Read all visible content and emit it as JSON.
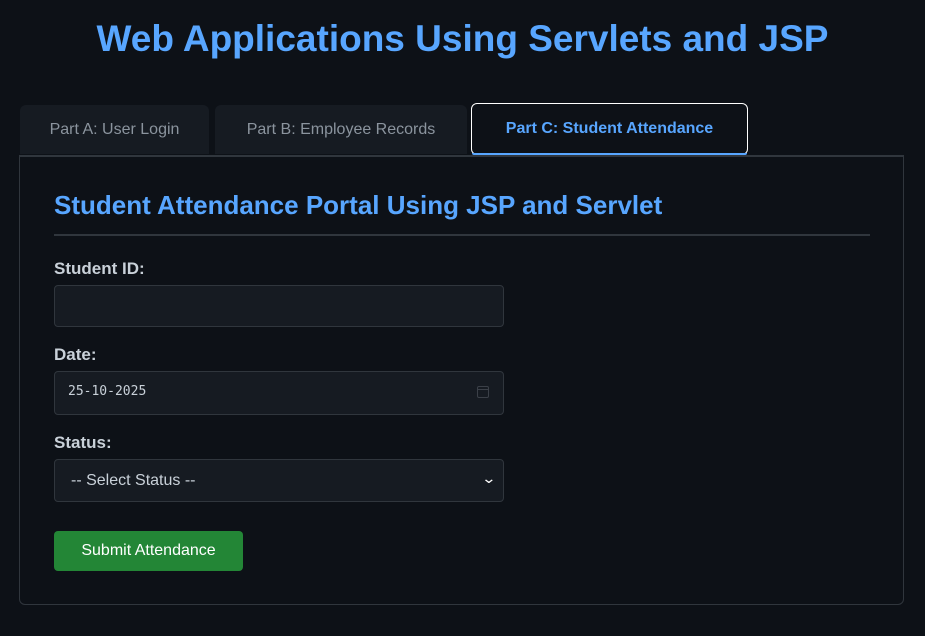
{
  "header": {
    "title": "Web Applications Using Servlets and JSP"
  },
  "tabs": [
    {
      "label": "Part A: User Login",
      "active": false
    },
    {
      "label": "Part B: Employee Records",
      "active": false
    },
    {
      "label": "Part C: Student Attendance",
      "active": true
    }
  ],
  "panel": {
    "title": "Student Attendance Portal Using JSP and Servlet",
    "form": {
      "student_id": {
        "label": "Student ID:",
        "value": ""
      },
      "date": {
        "label": "Date:",
        "value": "25-10-2025",
        "icon": "calendar-icon"
      },
      "status": {
        "label": "Status:",
        "selected": "-- Select Status --",
        "icon": "chevron-down-icon"
      },
      "submit_label": "Submit Attendance"
    }
  },
  "colors": {
    "background": "#0d1117",
    "accent": "#58a6ff",
    "submit": "#238636",
    "field_bg": "#161b22",
    "border": "#30363d"
  }
}
